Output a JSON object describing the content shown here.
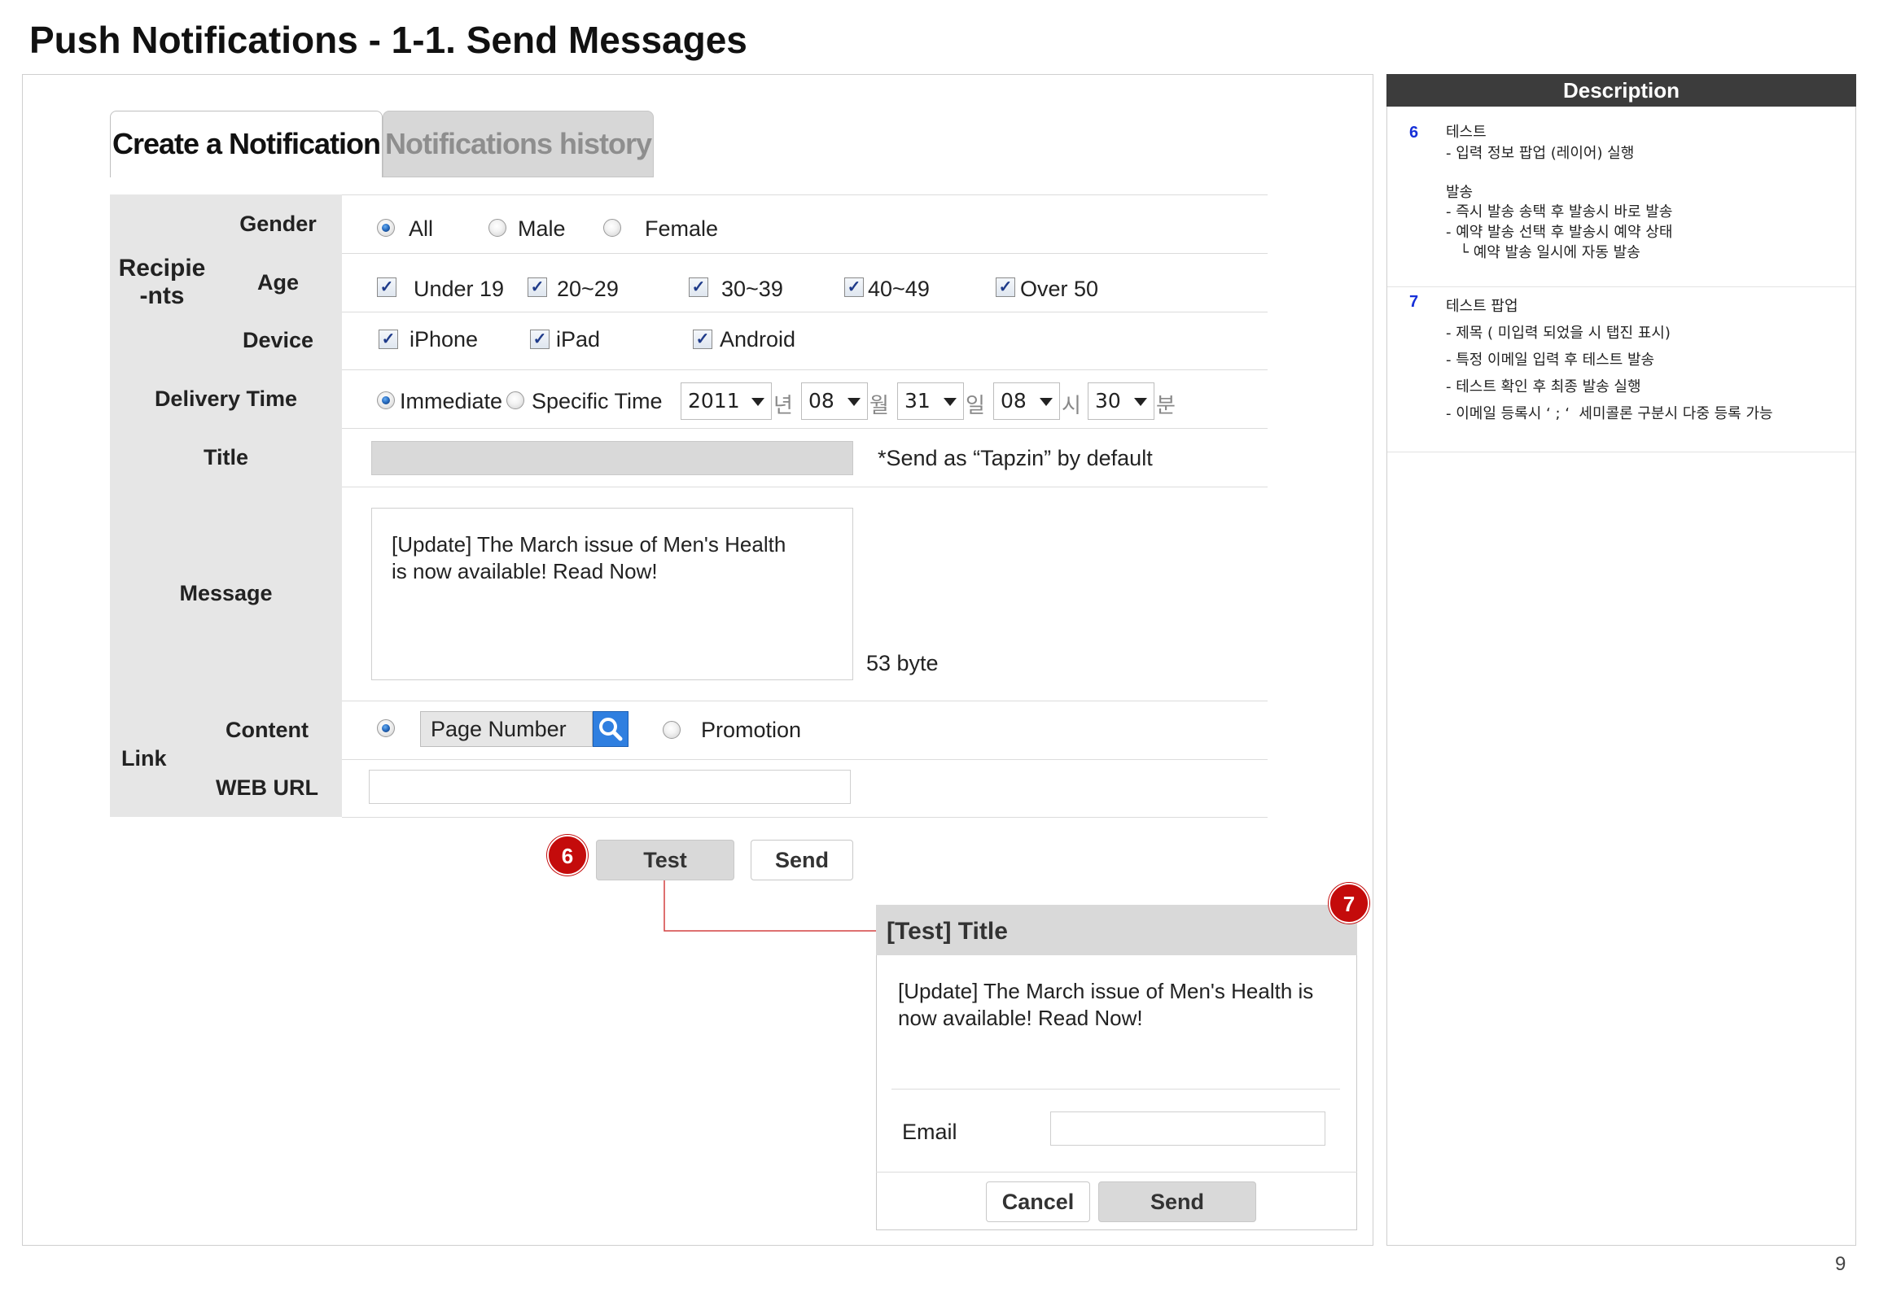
{
  "page_title": "Push Notifications - 1-1. Send Messages",
  "page_number": "9",
  "tabs": {
    "create": "Create a Notification",
    "history": "Notifications history"
  },
  "form": {
    "recipients_label": "Recipie\n-nts",
    "gender": {
      "label": "Gender",
      "options": [
        "All",
        "Male",
        "Female"
      ],
      "selected": "All"
    },
    "age": {
      "label": "Age",
      "options": [
        "Under 19",
        "20~29",
        "30~39",
        "40~49",
        "Over 50"
      ],
      "checked": true
    },
    "device": {
      "label": "Device",
      "options": [
        "iPhone",
        "iPad",
        "Android"
      ],
      "checked": true
    },
    "delivery": {
      "label": "Delivery Time",
      "options": [
        "Immediate",
        "Specific Time"
      ],
      "selected": "Immediate",
      "year": "2011",
      "year_unit": "년",
      "month": "08",
      "month_unit": "월",
      "day": "31",
      "day_unit": "일",
      "hour": "08",
      "hour_unit": "시",
      "minute": "30",
      "minute_unit": "분"
    },
    "title": {
      "label": "Title",
      "value": "",
      "hint": "*Send as “Tapzin” by default"
    },
    "message": {
      "label": "Message",
      "value": "[Update] The March issue of Men's Health\nis now available! Read Now!",
      "bytes": "53 byte"
    },
    "link": {
      "label": "Link",
      "content": {
        "label": "Content",
        "page_number": "Page Number",
        "promotion": "Promotion",
        "selected": "Page Number"
      },
      "web_url": {
        "label": "WEB URL",
        "value": ""
      }
    }
  },
  "buttons": {
    "test": "Test",
    "send": "Send"
  },
  "markers": {
    "test": "6",
    "popup": "7"
  },
  "popup": {
    "title": "[Test] Title",
    "message": "[Update] The March issue of Men's Health is now available! Read Now!",
    "email_label": "Email",
    "email_value": "",
    "cancel": "Cancel",
    "send": "Send"
  },
  "description": {
    "header": "Description",
    "sections": [
      {
        "num": "6",
        "lines": [
          "테스트",
          "- 입력 정보 팝업 (레이어) 실행",
          "",
          "발송",
          "- 즉시 발송 송택 후 발송시 바로 발송",
          "- 예약 발송 선택 후 발송시 예약 상태",
          "   └ 예약 발송 일시에 자동 발송"
        ]
      },
      {
        "num": "7",
        "lines": [
          "테스트 팝업",
          "- 제목 ( 미입력 되었을 시 탭진 표시)",
          "- 특정 이메일 입력 후 테스트 발송",
          "- 테스트 확인 후 최종 발송 실행",
          "- 이메일 등록시 ‘ ; ‘  세미콜론 구분시 다중 등록 가능"
        ]
      }
    ]
  },
  "colors": {
    "badge": "#c40b0b",
    "desc_header": "#3c3c3c",
    "desc_number": "#1630d8",
    "label_bg": "#e6e6e6",
    "search_button": "#2f7fe0"
  }
}
